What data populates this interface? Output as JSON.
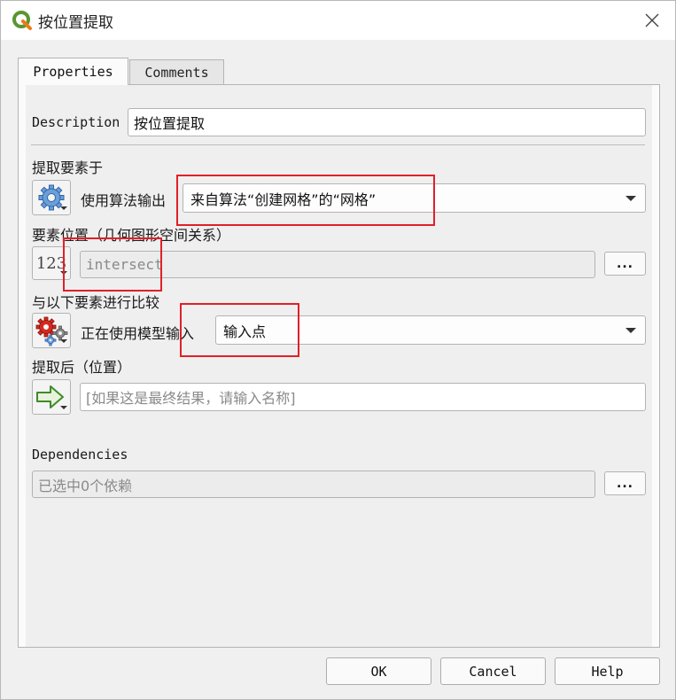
{
  "window": {
    "title": "按位置提取"
  },
  "tabs": {
    "properties": "Properties",
    "comments": "Comments"
  },
  "description": {
    "label": "Description",
    "value": "按位置提取"
  },
  "extract_features": {
    "label": "提取要素于",
    "source_label": "使用算法输出",
    "selected": "来自算法“创建网格”的“网格”"
  },
  "predicate": {
    "label": "要素位置（几何图形空间关系）",
    "value_button": "123",
    "value": "intersect",
    "more_button": "..."
  },
  "compare": {
    "label": "与以下要素进行比较",
    "source_label": "正在使用模型输入",
    "selected": "输入点"
  },
  "output": {
    "label": "提取后（位置）",
    "placeholder": "[如果这是最终结果，请输入名称]"
  },
  "dependencies": {
    "label": "Dependencies",
    "value": "已选中0个依赖",
    "more_button": "..."
  },
  "buttons": {
    "ok": "OK",
    "cancel": "Cancel",
    "help": "Help"
  },
  "colors": {
    "highlight": "#e0202a",
    "qgis_green": "#589632"
  },
  "icons": {
    "app": "qgis-logo-icon",
    "close": "close-icon",
    "algorithm_output": "gear-icon",
    "model_input": "multi-gear-icon",
    "output": "arrow-right-icon",
    "dropdown": "chevron-down-icon"
  }
}
